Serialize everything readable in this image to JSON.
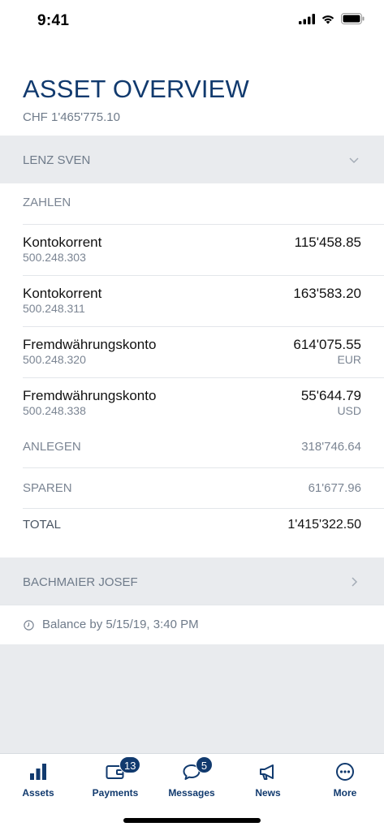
{
  "status": {
    "time": "9:41"
  },
  "header": {
    "title": "ASSET OVERVIEW",
    "subtitle": "CHF 1'465'775.10"
  },
  "person1": {
    "name": "LENZ SVEN",
    "group_label": "ZAHLEN",
    "accounts": [
      {
        "name": "Kontokorrent",
        "number": "500.248.303",
        "amount": "115'458.85",
        "currency": ""
      },
      {
        "name": "Kontokorrent",
        "number": "500.248.311",
        "amount": "163'583.20",
        "currency": ""
      },
      {
        "name": "Fremdwährungskonto",
        "number": "500.248.320",
        "amount": "614'075.55",
        "currency": "EUR"
      },
      {
        "name": "Fremdwährungskonto",
        "number": "500.248.338",
        "amount": "55'644.79",
        "currency": "USD"
      }
    ],
    "anlegen": {
      "label": "ANLEGEN",
      "value": "318'746.64"
    },
    "sparen": {
      "label": "SPAREN",
      "value": "61'677.96"
    },
    "total": {
      "label": "TOTAL",
      "value": "1'415'322.50"
    }
  },
  "person2": {
    "name": "BACHMAIER JOSEF"
  },
  "balance": {
    "text": "Balance by 5/15/19, 3:40 PM"
  },
  "tabs": [
    {
      "label": "Assets",
      "icon": "bar-chart-icon",
      "badge": ""
    },
    {
      "label": "Payments",
      "icon": "wallet-icon",
      "badge": "13"
    },
    {
      "label": "Messages",
      "icon": "speech-bubble-icon",
      "badge": "5"
    },
    {
      "label": "News",
      "icon": "megaphone-icon",
      "badge": ""
    },
    {
      "label": "More",
      "icon": "more-icon",
      "badge": ""
    }
  ],
  "colors": {
    "brand": "#113a6e",
    "muted": "#7b8593",
    "section_bg": "#e9ebee"
  }
}
